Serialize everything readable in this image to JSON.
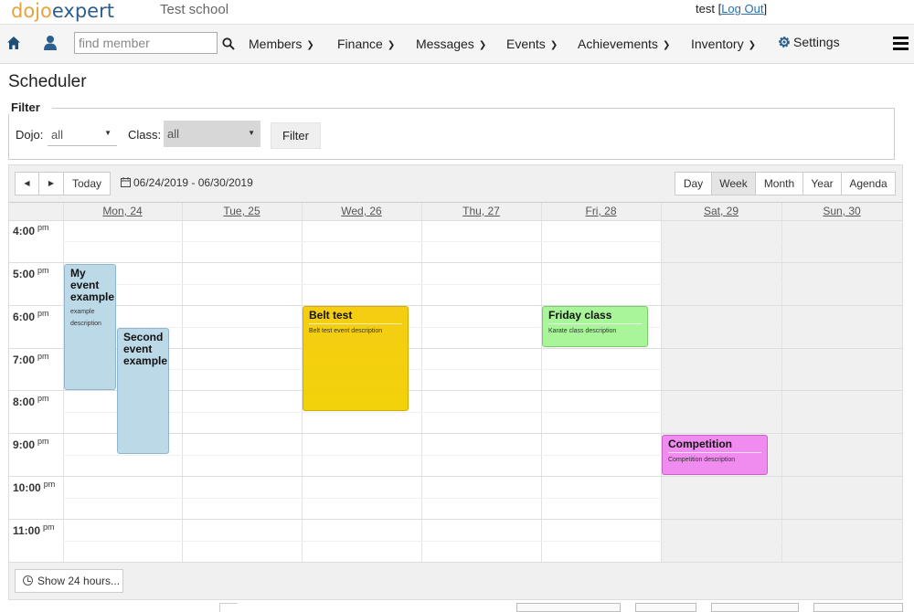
{
  "app": {
    "logo_part1": "dojo",
    "logo_part2": "expert",
    "school": "Test school",
    "user": "test",
    "logout_label": "Log Out"
  },
  "nav": {
    "search_placeholder": "find member",
    "items": [
      "Members",
      "Finance",
      "Messages",
      "Events",
      "Achievements",
      "Inventory",
      "Settings"
    ]
  },
  "page": {
    "title": "Scheduler"
  },
  "filter": {
    "legend": "Filter",
    "dojo_label": "Dojo:",
    "dojo_value": "all",
    "class_label": "Class:",
    "class_value": "all",
    "button": "Filter"
  },
  "toolbar": {
    "prev": "◀",
    "next": "▶",
    "today": "Today",
    "date_range": "06/24/2019 - 06/30/2019",
    "views": [
      "Day",
      "Week",
      "Month",
      "Year",
      "Agenda"
    ],
    "active_view": "Week"
  },
  "days": [
    "Mon, 24",
    "Tue, 25",
    "Wed, 26",
    "Thu, 27",
    "Fri, 28",
    "Sat, 29",
    "Sun, 30"
  ],
  "hours": [
    {
      "h": "4:00",
      "ap": "pm"
    },
    {
      "h": "5:00",
      "ap": "pm"
    },
    {
      "h": "6:00",
      "ap": "pm"
    },
    {
      "h": "7:00",
      "ap": "pm"
    },
    {
      "h": "8:00",
      "ap": "pm"
    },
    {
      "h": "9:00",
      "ap": "pm"
    },
    {
      "h": "10:00",
      "ap": "pm"
    },
    {
      "h": "11:00",
      "ap": "pm"
    }
  ],
  "events": [
    {
      "title": "My event example",
      "desc": "example description",
      "day": "Mon, 24",
      "color": "#bcd9e8",
      "border": "#8fb6cc"
    },
    {
      "title": "Second event example",
      "desc": "",
      "day": "Mon, 24",
      "color": "#bcd9e8",
      "border": "#8fb6cc"
    },
    {
      "title": "Belt test",
      "desc": "Belt test event description",
      "day": "Wed, 26",
      "color": "#f5cd12",
      "border": "#d4a900"
    },
    {
      "title": "Friday class",
      "desc": "Karate class description",
      "day": "Fri, 28",
      "color": "#a8f59a",
      "border": "#7ccb6e"
    },
    {
      "title": "Competition",
      "desc": "Competition description",
      "day": "Sat, 29",
      "color": "#f08cf0",
      "border": "#c763c7"
    }
  ],
  "bottom": {
    "show24": "Show 24 hours..."
  },
  "colors": {
    "accent": "#2a6fb0",
    "logo_orange": "#e8a33c",
    "logo_blue": "#2c5f8d"
  }
}
